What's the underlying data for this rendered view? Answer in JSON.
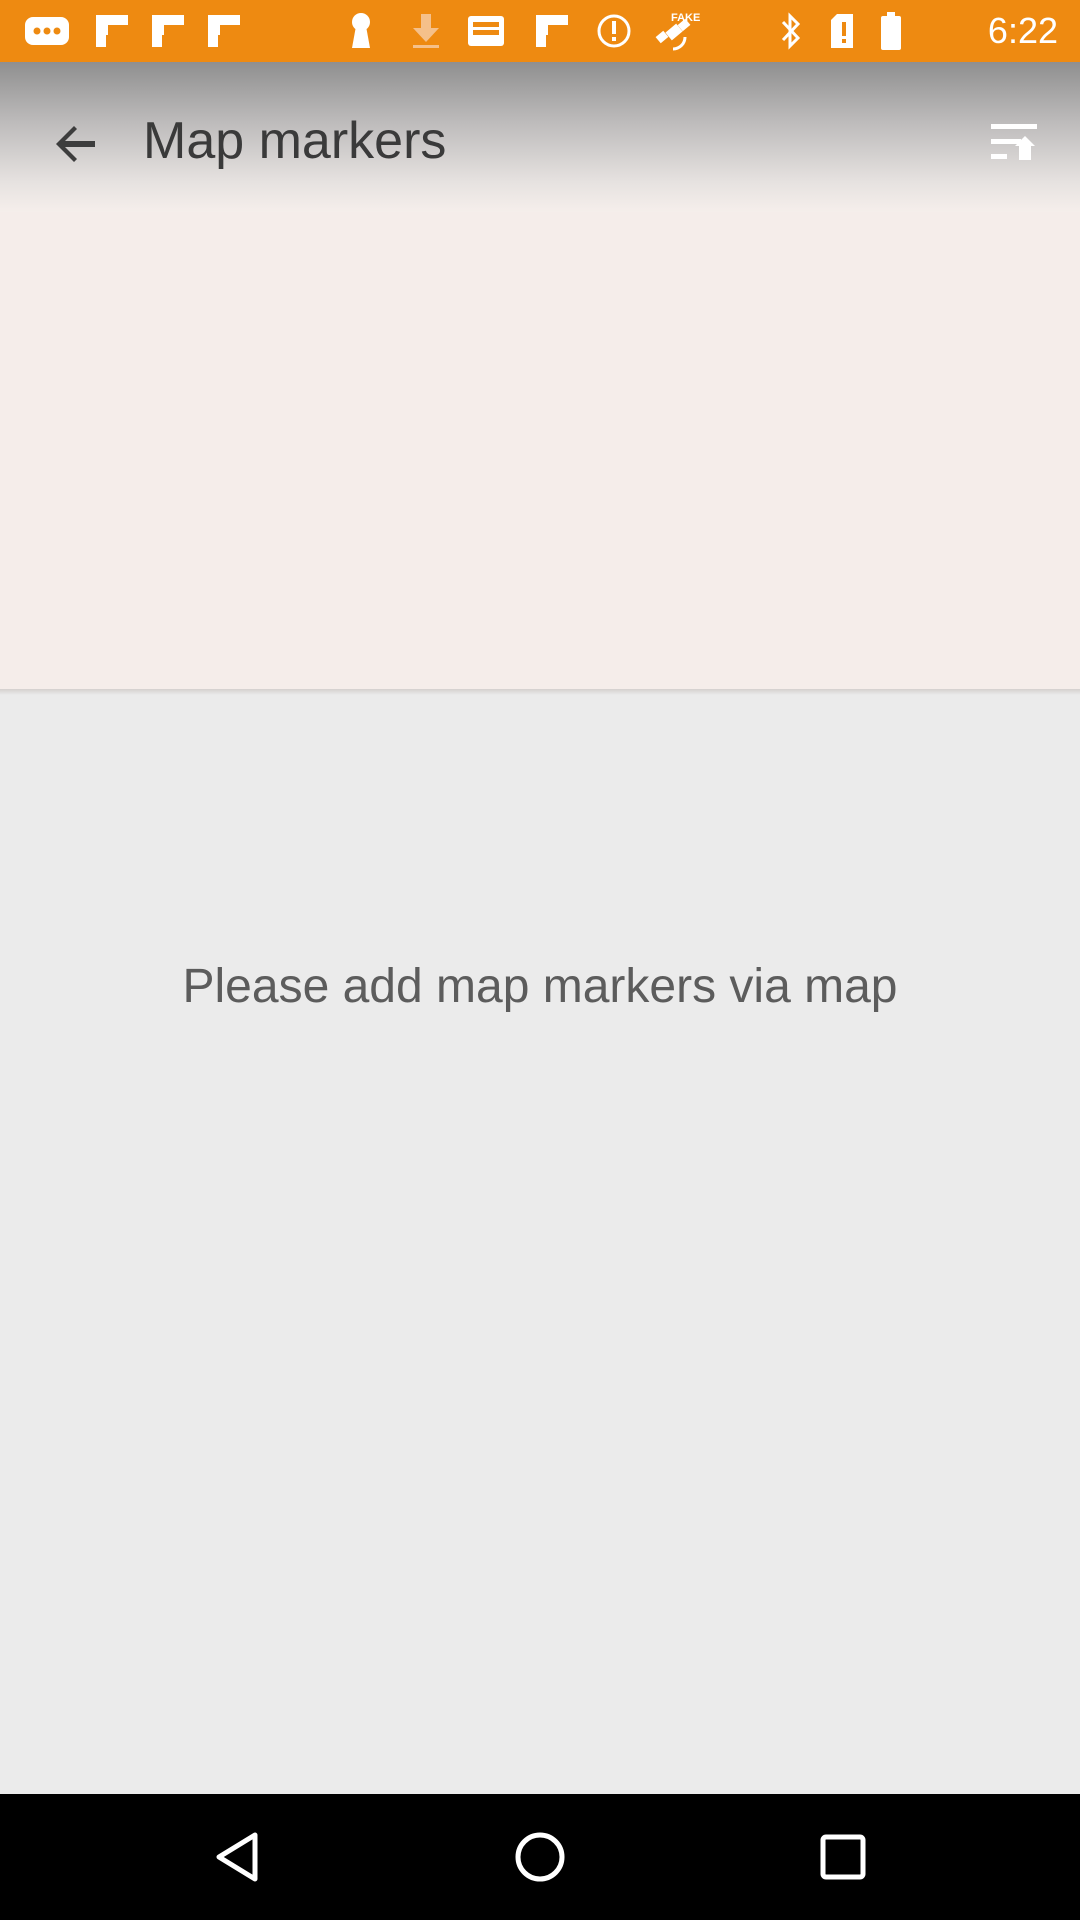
{
  "status_bar": {
    "time": "6:22",
    "background": "#ee8a11",
    "icons": [
      "more-notifications-icon",
      "flipboard-icon",
      "flipboard-icon",
      "flipboard-icon",
      "keyhole-icon",
      "download-icon",
      "inbox-icon",
      "flipboard-icon",
      "alert-icon",
      "fake-gps-satellite-icon",
      "bluetooth-icon",
      "no-sim-icon",
      "battery-icon"
    ]
  },
  "header": {
    "title": "Map markers",
    "back_icon": "arrow-back-icon",
    "sort_icon": "sort-ascending-icon"
  },
  "content": {
    "empty_message": "Please add map markers via map"
  },
  "nav_bar": {
    "icons": [
      "back-triangle-icon",
      "home-circle-icon",
      "recents-square-icon"
    ]
  }
}
